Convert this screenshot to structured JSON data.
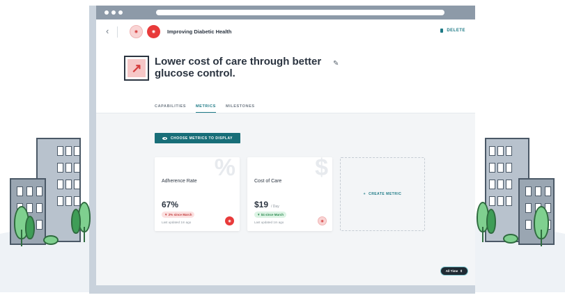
{
  "header": {
    "program_title": "Improving Diabetic Health",
    "delete_label": "DELETE",
    "back_glyph": "‹",
    "logo_left_text": "◉",
    "logo_right_text": "◉"
  },
  "goal": {
    "title": "Lower cost of care through better glucose control.",
    "icon": "trend-arrow-icon",
    "edit_glyph": "✎"
  },
  "tabs": [
    {
      "label": "CAPABILITIES",
      "active": false
    },
    {
      "label": "METRICS",
      "active": true
    },
    {
      "label": "MILESTONES",
      "active": false
    }
  ],
  "toolbar": {
    "choose_metrics_label": "CHOOSE METRICS TO DISPLAY"
  },
  "metrics": [
    {
      "name": "Adherence Rate",
      "watermark": "%",
      "value": "67%",
      "unit": "",
      "change": "▼ 2% since March",
      "trend": "down",
      "updated": "Last updated 1m ago"
    },
    {
      "name": "Cost of Care",
      "watermark": "$",
      "value": "$19",
      "unit": "/ Day",
      "change": "▼ $4 since March",
      "trend": "up",
      "updated": "Last updated 1m ago"
    }
  ],
  "create_metric": {
    "plus": "+",
    "label": "CREATE METRIC"
  },
  "time_filter": {
    "label": "All Time",
    "glyph": "⇕"
  },
  "colors": {
    "accent": "#1e7a86",
    "button": "#186e78",
    "down": "#c33b3b",
    "up": "#2b8a4f"
  }
}
